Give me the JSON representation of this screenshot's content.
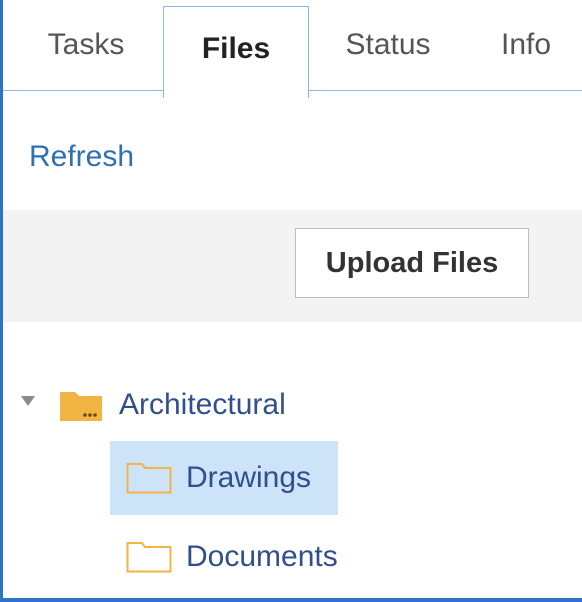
{
  "tabs": [
    {
      "label": "Tasks",
      "active": false
    },
    {
      "label": "Files",
      "active": true
    },
    {
      "label": "Status",
      "active": false
    },
    {
      "label": "Info",
      "active": false
    }
  ],
  "actions": {
    "refresh_label": "Refresh",
    "upload_label": "Upload Files"
  },
  "tree": {
    "root": {
      "label": "Architectural",
      "expanded": true,
      "icon": "folder-filled-icon"
    },
    "children": [
      {
        "label": "Drawings",
        "selected": true,
        "icon": "folder-outline-icon"
      },
      {
        "label": "Documents",
        "selected": false,
        "icon": "folder-outline-icon"
      }
    ]
  },
  "colors": {
    "accent": "#2f73c9",
    "link": "#2f6fb4",
    "folder": "#f2b544",
    "selection": "#cde3f7",
    "toolbar_bg": "#f3f3f3"
  }
}
